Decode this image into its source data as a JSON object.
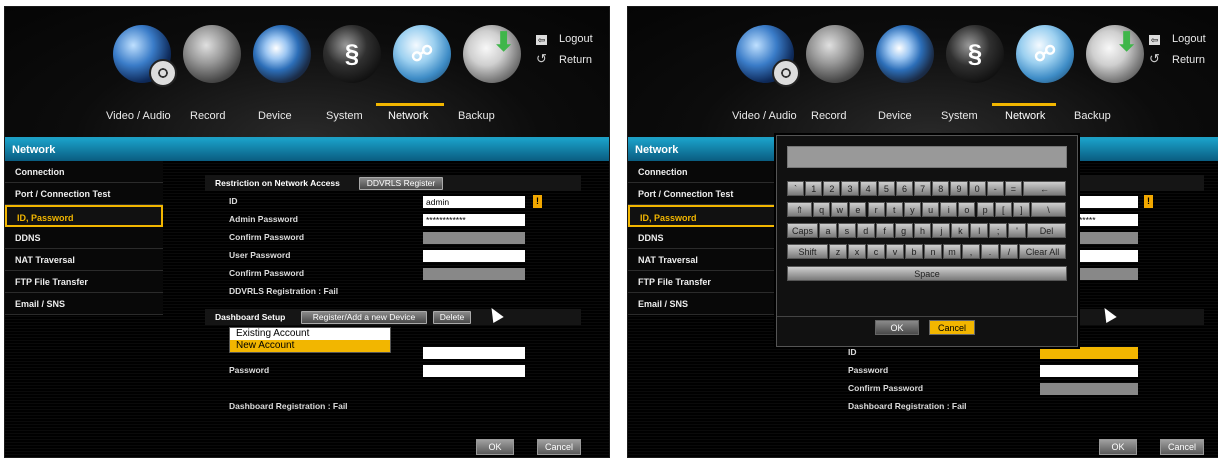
{
  "top": {
    "menu": [
      "Video / Audio",
      "Record",
      "Device",
      "System",
      "Network",
      "Backup"
    ],
    "logout": "Logout",
    "return": "Return"
  },
  "icons": [
    "video-audio-icon",
    "record-icon",
    "device-icon",
    "system-icon",
    "network-icon",
    "backup-icon"
  ],
  "title": "Network",
  "sidebar": [
    "Connection",
    "Port / Connection Test",
    "ID, Password",
    "DDNS",
    "NAT Traversal",
    "FTP File Transfer",
    "Email / SNS"
  ],
  "restriction": {
    "label": "Restriction on Network Access",
    "register_btn": "DDVRLS Register",
    "id_label": "ID",
    "id_value": "admin",
    "admin_pw_label": "Admin Password",
    "admin_pw_value": "************",
    "confirm_pw_label": "Confirm Password",
    "user_pw_label": "User Password",
    "confirm_pw2_label": "Confirm Password",
    "registration": "DDVRLS Registration  :  Fail"
  },
  "dashboard": {
    "label": "Dashboard Setup",
    "register_btn": "Register/Add a new Device",
    "delete_btn": "Delete",
    "options": [
      "Existing Account",
      "New Account"
    ],
    "id_label": "ID",
    "password_label": "Password",
    "confirm_pw_label": "Confirm Password",
    "registration": "Dashboard Registration  :  Fail"
  },
  "buttons": {
    "ok": "OK",
    "cancel": "Cancel"
  },
  "keyboard": {
    "row1": [
      "`",
      "1",
      "2",
      "3",
      "4",
      "5",
      "6",
      "7",
      "8",
      "9",
      "0",
      "-",
      "=",
      "←"
    ],
    "row2": [
      "⇑",
      "q",
      "w",
      "e",
      "r",
      "t",
      "y",
      "u",
      "i",
      "o",
      "p",
      "[",
      "]",
      "\\"
    ],
    "row3": [
      "Caps",
      "a",
      "s",
      "d",
      "f",
      "g",
      "h",
      "j",
      "k",
      "l",
      ";",
      "'",
      "Del"
    ],
    "row4": [
      "Shift",
      "z",
      "x",
      "c",
      "v",
      "b",
      "n",
      "m",
      ",",
      ".",
      "/",
      "Clear All"
    ],
    "space": "Space",
    "ok": "OK",
    "cancel": "Cancel",
    "masked": "*****"
  },
  "colors": {
    "accent": "#f2b600",
    "titlebar": "#1aa0c8"
  }
}
